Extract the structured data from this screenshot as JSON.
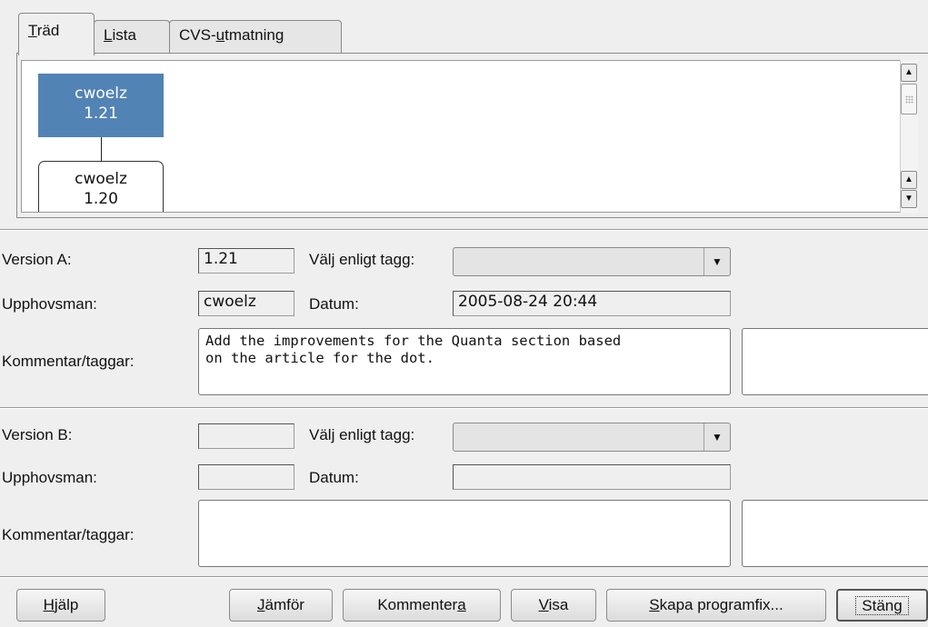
{
  "tabs": [
    {
      "pre": "",
      "mn": "T",
      "post": "räd"
    },
    {
      "pre": "",
      "mn": "L",
      "post": "ista"
    },
    {
      "pre": "CVS-",
      "mn": "u",
      "post": "tmatning"
    }
  ],
  "tree": {
    "nodes": [
      {
        "author": "cwoelz",
        "rev": "1.21"
      },
      {
        "author": "cwoelz",
        "rev": "1.20"
      }
    ]
  },
  "version_a": {
    "version_label": "Version A:",
    "version_value": "1.21",
    "tag_label": "Välj enligt tagg:",
    "tag_value": "",
    "author_label": "Upphovsman:",
    "author_value": "cwoelz",
    "date_label": "Datum:",
    "date_value": "2005-08-24 20:44",
    "comment_label": "Kommentar/taggar:",
    "comment_value": "Add the improvements for the Quanta section based\non the article for the dot.",
    "tags_value": ""
  },
  "version_b": {
    "version_label": "Version B:",
    "version_value": "",
    "tag_label": "Välj enligt tagg:",
    "tag_value": "",
    "author_label": "Upphovsman:",
    "author_value": "",
    "date_label": "Datum:",
    "date_value": "",
    "comment_label": "Kommentar/taggar:",
    "comment_value": "",
    "tags_value": ""
  },
  "buttons": {
    "help": {
      "pre": "",
      "mn": "H",
      "post": "jälp"
    },
    "compare": {
      "pre": "",
      "mn": "J",
      "post": "ämför"
    },
    "annotate": {
      "pre": "Kommenter",
      "mn": "a",
      "post": ""
    },
    "view": {
      "pre": "",
      "mn": "V",
      "post": "isa"
    },
    "patch": {
      "pre": "",
      "mn": "S",
      "post": "kapa programfix..."
    },
    "close": {
      "pre": "Stän",
      "mn": "g",
      "post": ""
    }
  },
  "icons": {
    "scroll_up": "▲",
    "scroll_down": "▼",
    "dropdown": "▼"
  }
}
